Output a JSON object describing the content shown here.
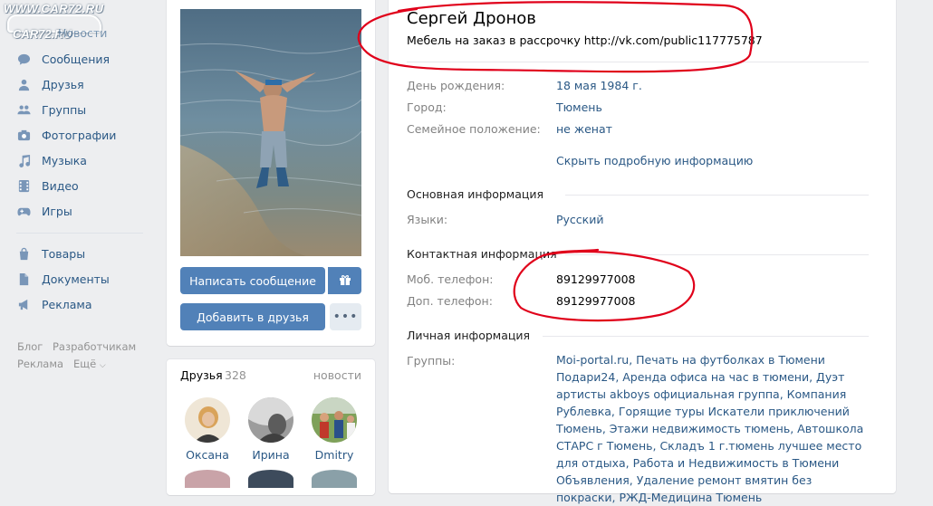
{
  "watermark": {
    "line1": "WWW.CAR72.RU",
    "line2": "CAR72.RU"
  },
  "nav": {
    "news": "Новости",
    "items": [
      {
        "label": "Сообщения",
        "icon": "messages-icon"
      },
      {
        "label": "Друзья",
        "icon": "friends-icon"
      },
      {
        "label": "Группы",
        "icon": "groups-icon"
      },
      {
        "label": "Фотографии",
        "icon": "photos-icon"
      },
      {
        "label": "Музыка",
        "icon": "music-icon"
      },
      {
        "label": "Видео",
        "icon": "video-icon"
      },
      {
        "label": "Игры",
        "icon": "games-icon"
      }
    ],
    "items2": [
      {
        "label": "Товары",
        "icon": "goods-icon"
      },
      {
        "label": "Документы",
        "icon": "documents-icon"
      },
      {
        "label": "Реклама",
        "icon": "ads-icon"
      }
    ],
    "footer": {
      "blog": "Блог",
      "developers": "Разработчикам",
      "ads": "Реклама",
      "more": "Ещё"
    }
  },
  "actions": {
    "write_message": "Написать сообщение",
    "add_friend": "Добавить в друзья"
  },
  "friends": {
    "title": "Друзья",
    "count": "328",
    "news_link": "новости",
    "list": [
      {
        "name": "Оксана"
      },
      {
        "name": "Ирина"
      },
      {
        "name": "Dmitry"
      }
    ]
  },
  "profile": {
    "name": "Сергей Дронов",
    "status": "Мебель на заказ в рассрочку http://vk.com/public117775787",
    "birthday_label": "День рождения:",
    "birthday": "18 мая 1984 г.",
    "city_label": "Город:",
    "city": "Тюмень",
    "family_label": "Семейное положение:",
    "family": "не женат",
    "hide_details": "Скрыть подробную информацию",
    "main_section": "Основная информация",
    "languages_label": "Языки:",
    "languages": "Русский",
    "contact_section": "Контактная информация",
    "mobile_label": "Моб. телефон:",
    "mobile": "89129977008",
    "extra_label": "Доп. телефон:",
    "extra": "89129977008",
    "personal_section": "Личная информация",
    "groups_label": "Группы:",
    "groups": "Moi-portal.ru, Печать на футболках в Тюмени Подари24, Аренда офиса на час в тюмени, Дуэт артисты akboys официальная группа, Компания Рублевка, Горящие туры Искатели приключений Тюмень, Этажи недвижимость тюмень, Автошкола СТАРС г Тюмень, Складъ 1 г.тюмень лучшее место для отдыха, Работа и Недвижимость в Тюмени Объявления, Удаление ремонт вмятин без покраски, РЖД-Медицина Тюмень"
  },
  "colors": {
    "link": "#2a5885",
    "button": "#5181b8",
    "background": "#edeef0",
    "annotation": "#e0001a"
  }
}
